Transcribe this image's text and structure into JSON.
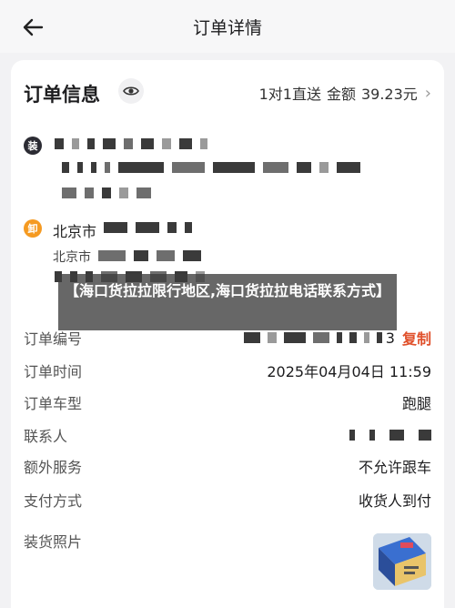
{
  "header": {
    "title": "订单详情",
    "back_icon": "arrow-left-icon"
  },
  "order_info": {
    "title": "订单信息",
    "summary_service": "1对1直送",
    "summary_amount_label": "金额",
    "summary_amount": "39.23元",
    "chevron": "›"
  },
  "route": {
    "load_badge": "装",
    "unload_badge": "卸",
    "unload_city": "北京市",
    "unload_subcity": "北京市"
  },
  "watermark": "【海口货拉拉限行地区,海口货拉拉电话联系方式】",
  "details": [
    {
      "label": "订单编号",
      "value": "3",
      "action": "复制"
    },
    {
      "label": "订单时间",
      "value": "2025年04月04日 11:59"
    },
    {
      "label": "订单车型",
      "value": "跑腿"
    },
    {
      "label": "联系人",
      "value": ""
    },
    {
      "label": "额外服务",
      "value": "不允许跟车"
    },
    {
      "label": "支付方式",
      "value": "收货人到付"
    },
    {
      "label": "装货照片",
      "value": ""
    }
  ],
  "colors": {
    "accent": "#e0502b",
    "unload_badge": "#f59a21",
    "load_badge": "#2b2b33"
  }
}
